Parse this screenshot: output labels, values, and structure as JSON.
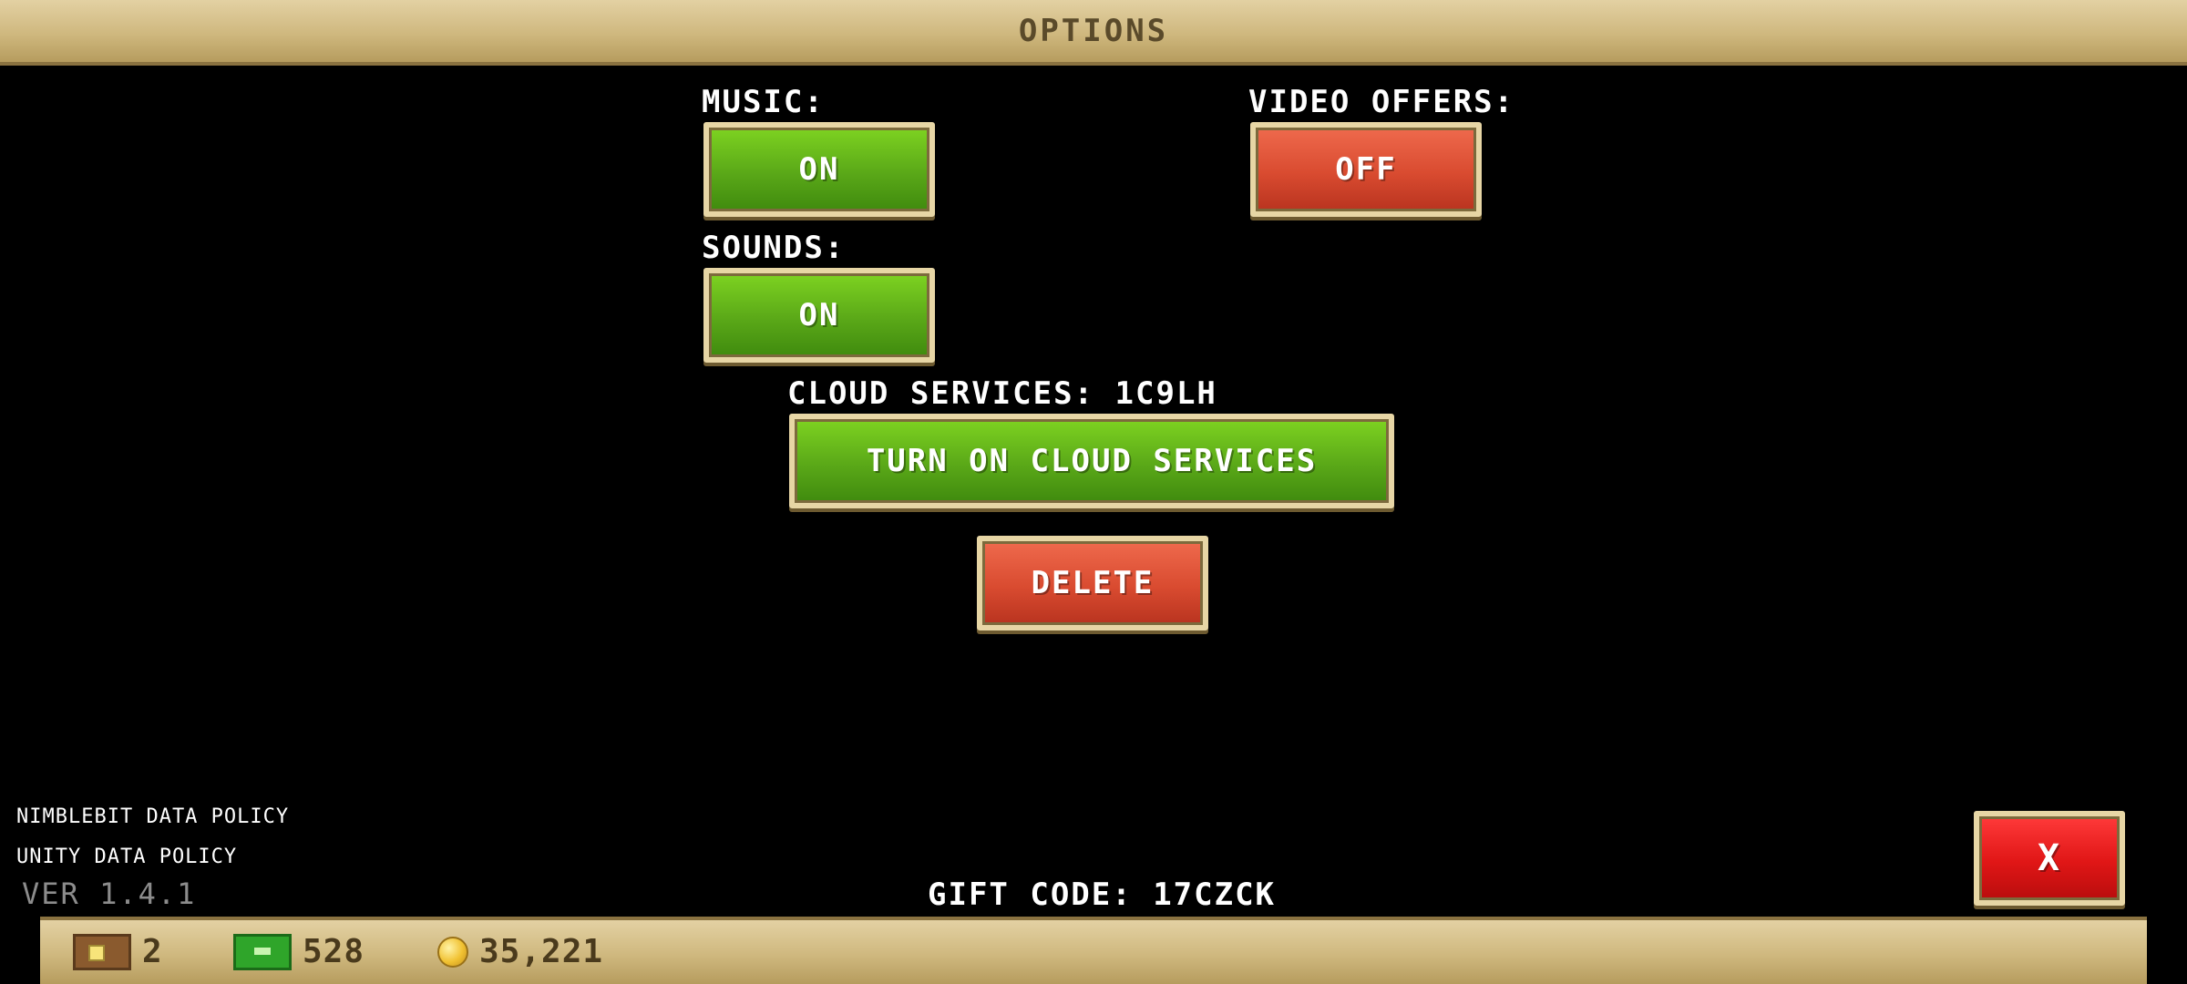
{
  "header": {
    "title": "OPTIONS"
  },
  "music": {
    "label": "MUSIC:",
    "button": "ON"
  },
  "sounds": {
    "label": "SOUNDS:",
    "button": "ON"
  },
  "video_offers": {
    "label": "VIDEO OFFERS:",
    "button": "OFF"
  },
  "cloud": {
    "label": "CLOUD SERVICES:",
    "code": "1C9LH",
    "button": "TURN ON CLOUD SERVICES"
  },
  "delete": {
    "button": "DELETE"
  },
  "links": {
    "nimblebit": "NIMBLEBIT DATA POLICY",
    "unity": "UNITY DATA POLICY"
  },
  "version": "VER 1.4.1",
  "gift": {
    "label": "GIFT CODE:",
    "code": "17CZCK"
  },
  "close": {
    "button": "X"
  },
  "stats": {
    "rooms": "2",
    "bux": "528",
    "coins": "35,221"
  },
  "colors": {
    "bar": "#cfb87e",
    "green": "#5aa818",
    "red": "#d94b30",
    "close_red": "#e01616"
  }
}
